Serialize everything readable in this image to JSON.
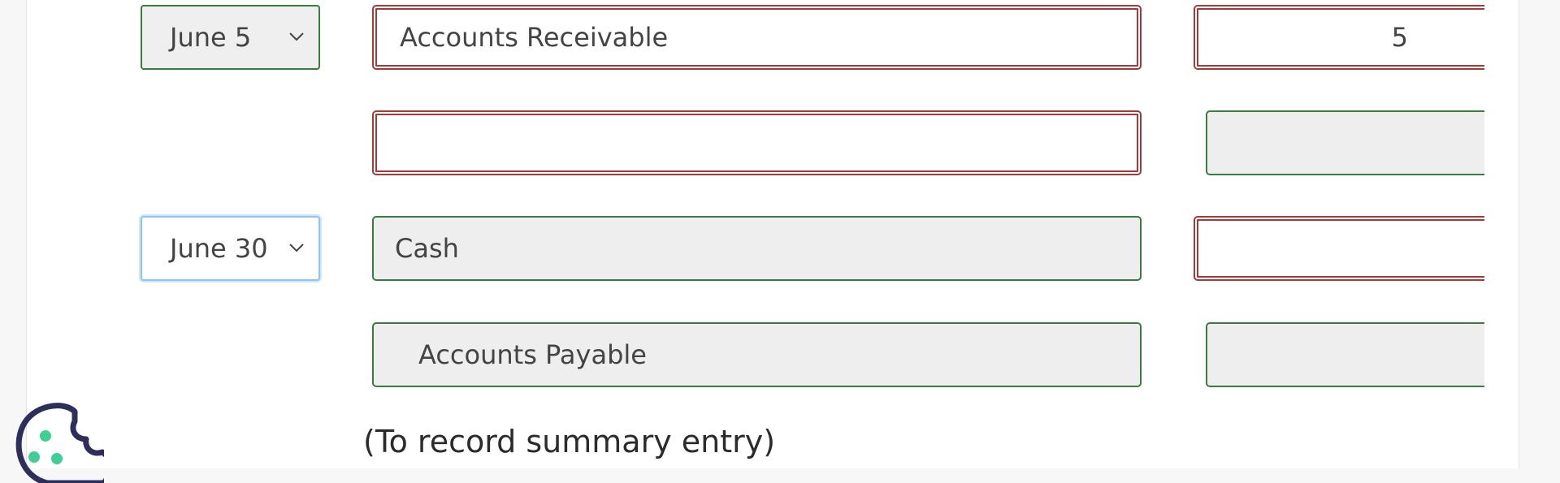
{
  "rows": [
    {
      "date": "June 5",
      "account": "Accounts Receivable",
      "amount": "5"
    },
    {
      "date": "",
      "account": "",
      "amount": ""
    },
    {
      "date": "June 30",
      "account": "Cash",
      "amount": ""
    },
    {
      "date": "",
      "account": "Accounts Payable",
      "amount": ""
    }
  ],
  "note": "(To record summary entry)",
  "icons": {
    "dropdown": "chevron-down-icon",
    "cookie": "cookie-icon"
  },
  "colors": {
    "error_border": "#a23a3a",
    "valid_border": "#3d7a3d",
    "focus_border": "#8cc4f3"
  }
}
